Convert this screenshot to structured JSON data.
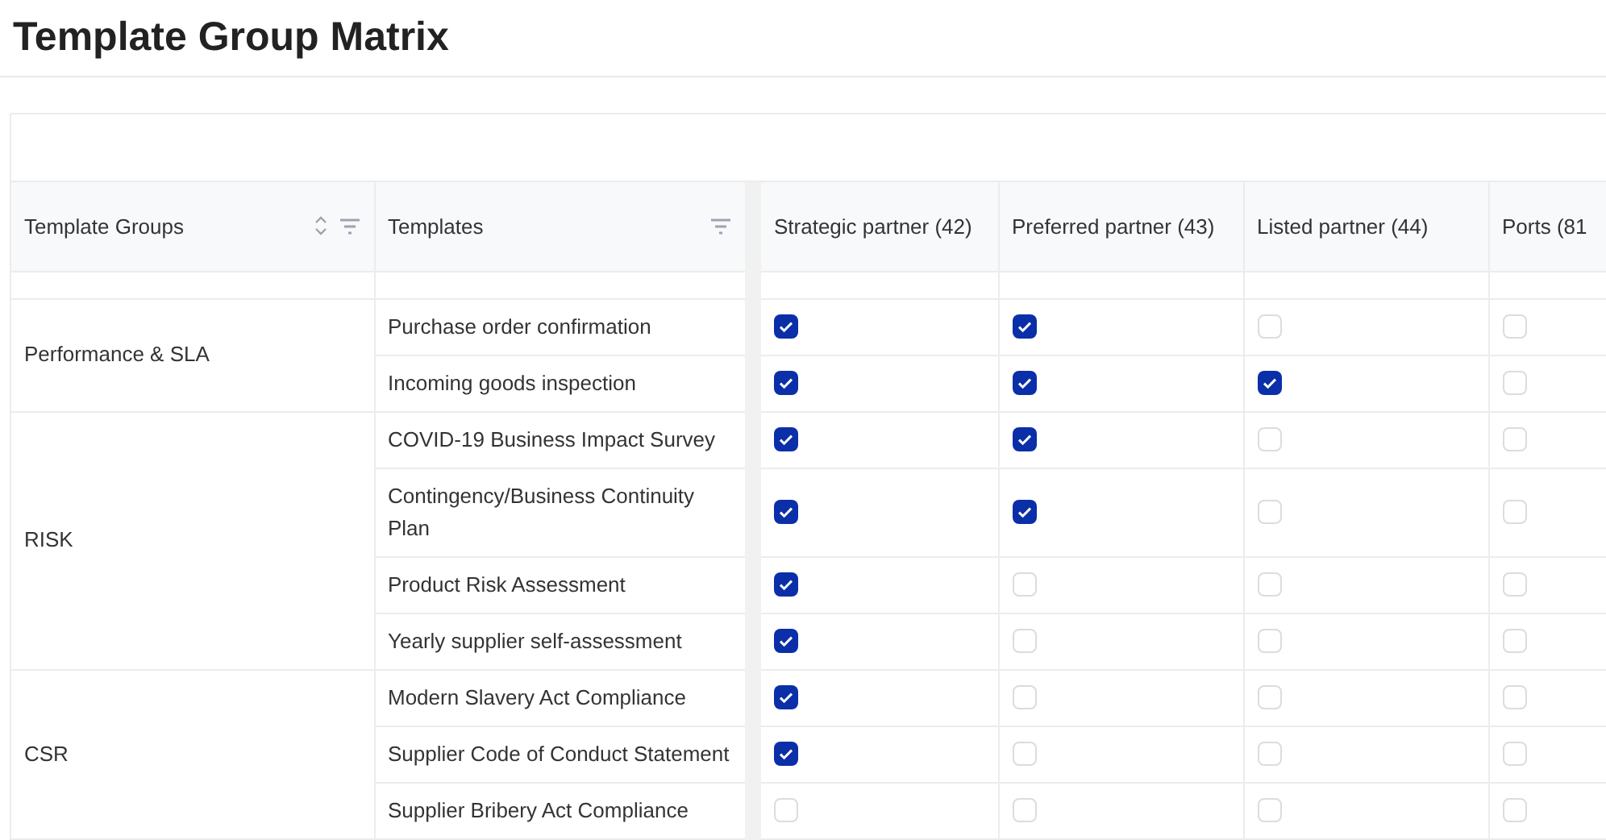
{
  "title": "Template Group Matrix",
  "columns": [
    "Template Groups",
    "Templates",
    "Strategic partner (42)",
    "Preferred partner (43)",
    "Listed partner (44)",
    "Ports (81"
  ],
  "groups": [
    {
      "name": "Performance & SLA",
      "templates": [
        {
          "name": "Purchase order confirmation",
          "checked": [
            true,
            true,
            false,
            false
          ]
        },
        {
          "name": "Incoming goods inspection",
          "checked": [
            true,
            true,
            true,
            false
          ]
        }
      ]
    },
    {
      "name": "RISK",
      "templates": [
        {
          "name": "COVID-19 Business Impact Survey",
          "checked": [
            true,
            true,
            false,
            false
          ]
        },
        {
          "name": "Contingency/Business Continuity Plan",
          "checked": [
            true,
            true,
            false,
            false
          ]
        },
        {
          "name": "Product Risk Assessment",
          "checked": [
            true,
            false,
            false,
            false
          ]
        },
        {
          "name": "Yearly supplier self-assessment",
          "checked": [
            true,
            false,
            false,
            false
          ]
        }
      ]
    },
    {
      "name": "CSR",
      "templates": [
        {
          "name": "Modern Slavery Act Compliance",
          "checked": [
            true,
            false,
            false,
            false
          ]
        },
        {
          "name": "Supplier Code of Conduct Statement",
          "checked": [
            true,
            false,
            false,
            false
          ]
        },
        {
          "name": "Supplier Bribery Act Compliance",
          "checked": [
            false,
            false,
            false,
            false
          ]
        }
      ]
    }
  ]
}
